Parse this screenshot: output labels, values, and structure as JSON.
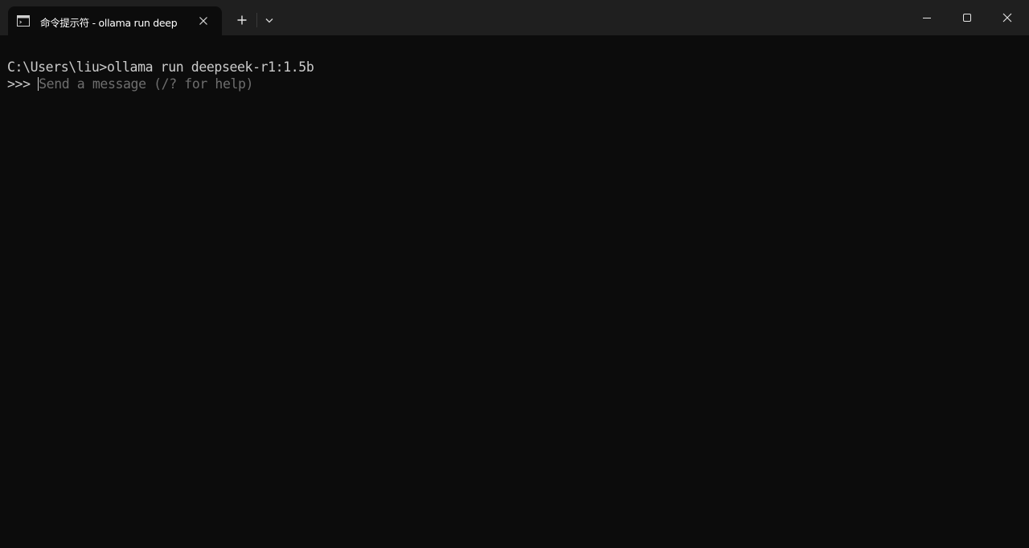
{
  "tab": {
    "title": "命令提示符 - ollama  run deep",
    "icon": "terminal-icon"
  },
  "titlebar": {
    "new_tab_icon": "plus-icon",
    "dropdown_icon": "chevron-down-icon",
    "minimize_icon": "minimize-icon",
    "maximize_icon": "maximize-icon",
    "close_icon": "close-icon"
  },
  "terminal": {
    "lines": [
      "C:\\Users\\liu>ollama run deepseek-r1:1.5b"
    ],
    "prompt": ">>> ",
    "placeholder": "Send a message (/? for help)"
  },
  "colors": {
    "background": "#0c0c0c",
    "titlebar": "#1f1f1f",
    "text": "#cccccc",
    "placeholder": "#6e6e6e"
  }
}
